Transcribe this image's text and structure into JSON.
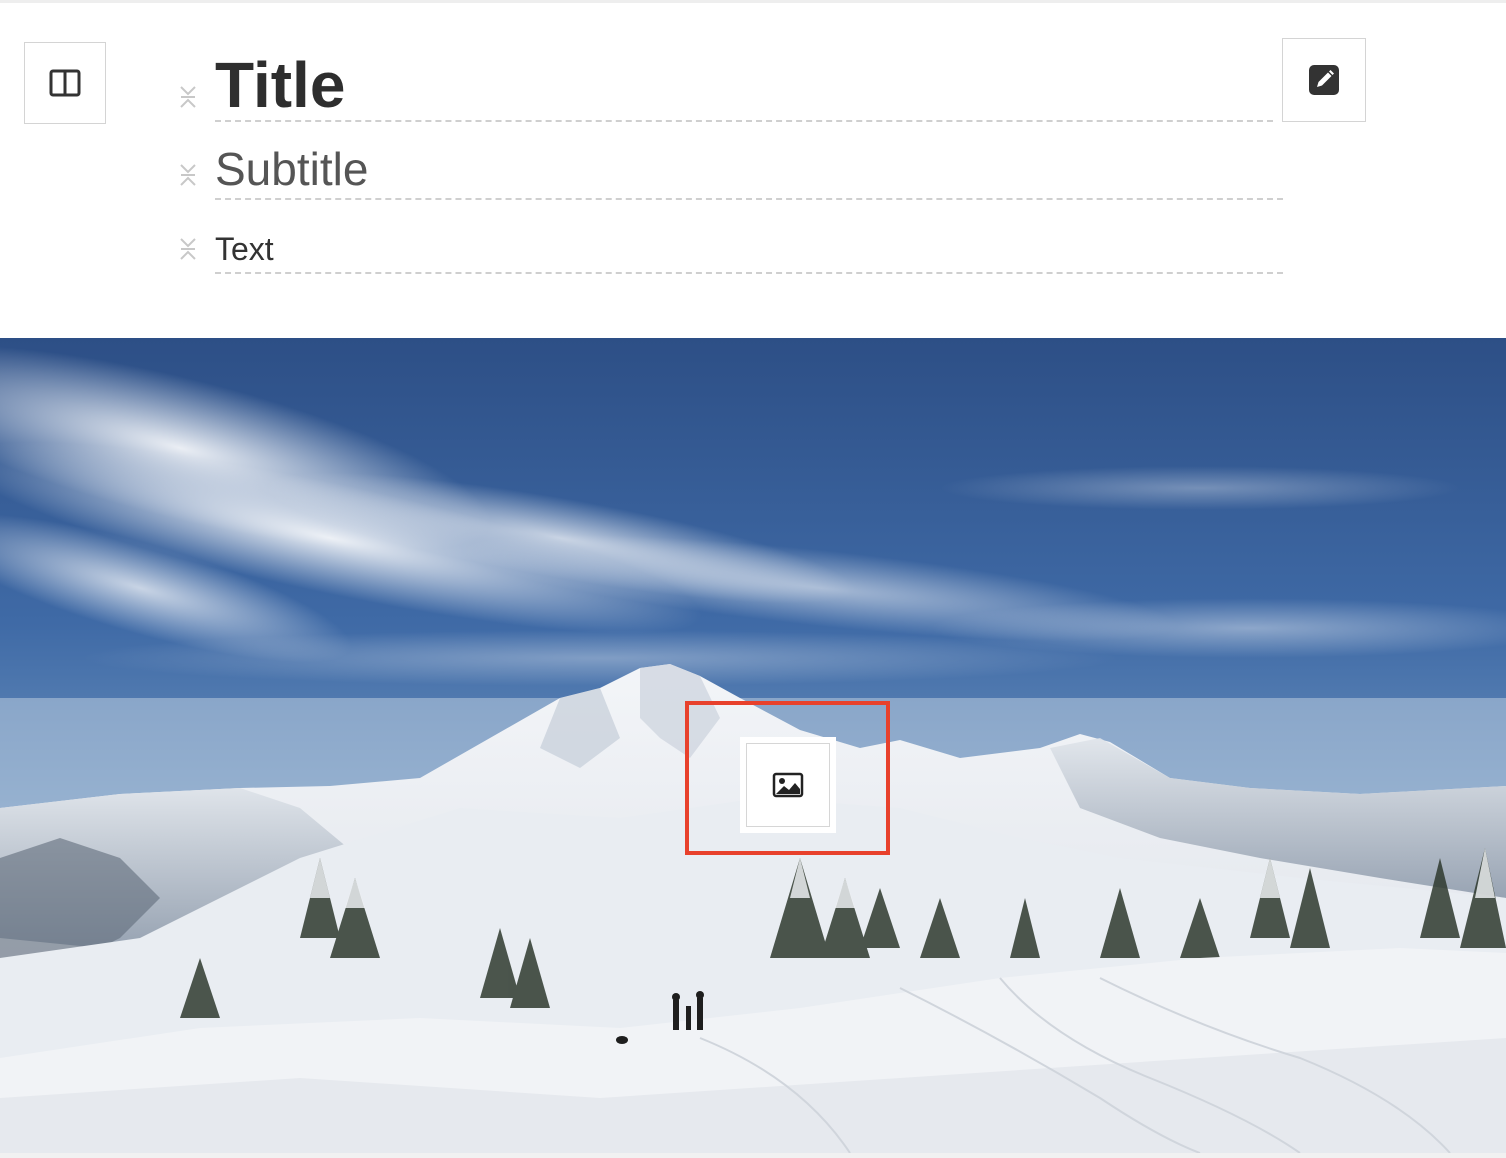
{
  "editor": {
    "title_block": "Title",
    "subtitle_block": "Subtitle",
    "text_block": "Text"
  },
  "icons": {
    "layout": "layout-columns-icon",
    "edit": "pencil-icon",
    "drag": "drag-handle-icon",
    "image": "image-icon"
  },
  "colors": {
    "highlight": "#e8412c",
    "text": "#333333",
    "divider": "#cfcfcf"
  }
}
